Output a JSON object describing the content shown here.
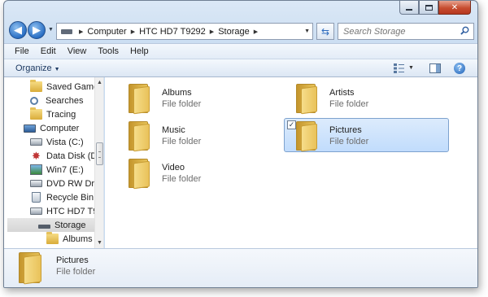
{
  "address": {
    "crumbs": [
      "Computer",
      "HTC HD7 T9292",
      "Storage"
    ]
  },
  "search": {
    "placeholder": "Search Storage"
  },
  "menu": [
    "File",
    "Edit",
    "View",
    "Tools",
    "Help"
  ],
  "toolbar": {
    "organize_label": "Organize"
  },
  "nav_tree": [
    {
      "label": "Saved Game",
      "icon": "saved-games-folder-icon"
    },
    {
      "label": "Searches",
      "icon": "searches-icon"
    },
    {
      "label": "Tracing",
      "icon": "folder-icon"
    },
    {
      "label": "Computer",
      "icon": "computer-icon"
    },
    {
      "label": "Vista (C:)",
      "icon": "drive-icon"
    },
    {
      "label": "Data Disk (D:",
      "icon": "data-disk-icon"
    },
    {
      "label": "Win7 (E:)",
      "icon": "windows-drive-icon"
    },
    {
      "label": "DVD RW Driv",
      "icon": "dvd-drive-icon"
    },
    {
      "label": "Recycle Bin",
      "icon": "recycle-bin-icon"
    },
    {
      "label": "HTC HD7 T9",
      "icon": "phone-device-icon"
    },
    {
      "label": "Storage",
      "icon": "storage-icon",
      "selected": true
    },
    {
      "label": "Albums",
      "icon": "folder-icon"
    }
  ],
  "items": [
    {
      "name": "Albums",
      "type": "File folder"
    },
    {
      "name": "Artists",
      "type": "File folder"
    },
    {
      "name": "Music",
      "type": "File folder"
    },
    {
      "name": "Pictures",
      "type": "File folder",
      "selected": true,
      "checked": true
    },
    {
      "name": "Video",
      "type": "File folder"
    }
  ],
  "details": {
    "name": "Pictures",
    "type": "File folder"
  },
  "colors": {
    "selection": "#c1dcfc",
    "selection_border": "#7da2ce",
    "chrome": "#c9dcf1"
  }
}
